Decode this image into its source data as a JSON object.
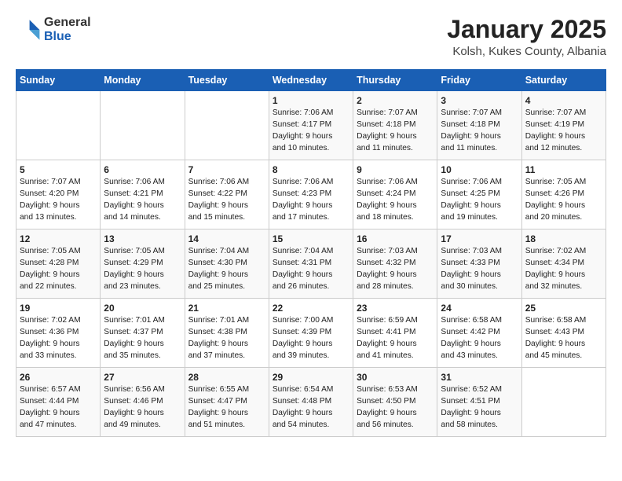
{
  "logo": {
    "general": "General",
    "blue": "Blue"
  },
  "title": "January 2025",
  "subtitle": "Kolsh, Kukes County, Albania",
  "days_of_week": [
    "Sunday",
    "Monday",
    "Tuesday",
    "Wednesday",
    "Thursday",
    "Friday",
    "Saturday"
  ],
  "weeks": [
    [
      {
        "day": "",
        "content": ""
      },
      {
        "day": "",
        "content": ""
      },
      {
        "day": "",
        "content": ""
      },
      {
        "day": "1",
        "content": "Sunrise: 7:06 AM\nSunset: 4:17 PM\nDaylight: 9 hours\nand 10 minutes."
      },
      {
        "day": "2",
        "content": "Sunrise: 7:07 AM\nSunset: 4:18 PM\nDaylight: 9 hours\nand 11 minutes."
      },
      {
        "day": "3",
        "content": "Sunrise: 7:07 AM\nSunset: 4:18 PM\nDaylight: 9 hours\nand 11 minutes."
      },
      {
        "day": "4",
        "content": "Sunrise: 7:07 AM\nSunset: 4:19 PM\nDaylight: 9 hours\nand 12 minutes."
      }
    ],
    [
      {
        "day": "5",
        "content": "Sunrise: 7:07 AM\nSunset: 4:20 PM\nDaylight: 9 hours\nand 13 minutes."
      },
      {
        "day": "6",
        "content": "Sunrise: 7:06 AM\nSunset: 4:21 PM\nDaylight: 9 hours\nand 14 minutes."
      },
      {
        "day": "7",
        "content": "Sunrise: 7:06 AM\nSunset: 4:22 PM\nDaylight: 9 hours\nand 15 minutes."
      },
      {
        "day": "8",
        "content": "Sunrise: 7:06 AM\nSunset: 4:23 PM\nDaylight: 9 hours\nand 17 minutes."
      },
      {
        "day": "9",
        "content": "Sunrise: 7:06 AM\nSunset: 4:24 PM\nDaylight: 9 hours\nand 18 minutes."
      },
      {
        "day": "10",
        "content": "Sunrise: 7:06 AM\nSunset: 4:25 PM\nDaylight: 9 hours\nand 19 minutes."
      },
      {
        "day": "11",
        "content": "Sunrise: 7:05 AM\nSunset: 4:26 PM\nDaylight: 9 hours\nand 20 minutes."
      }
    ],
    [
      {
        "day": "12",
        "content": "Sunrise: 7:05 AM\nSunset: 4:28 PM\nDaylight: 9 hours\nand 22 minutes."
      },
      {
        "day": "13",
        "content": "Sunrise: 7:05 AM\nSunset: 4:29 PM\nDaylight: 9 hours\nand 23 minutes."
      },
      {
        "day": "14",
        "content": "Sunrise: 7:04 AM\nSunset: 4:30 PM\nDaylight: 9 hours\nand 25 minutes."
      },
      {
        "day": "15",
        "content": "Sunrise: 7:04 AM\nSunset: 4:31 PM\nDaylight: 9 hours\nand 26 minutes."
      },
      {
        "day": "16",
        "content": "Sunrise: 7:03 AM\nSunset: 4:32 PM\nDaylight: 9 hours\nand 28 minutes."
      },
      {
        "day": "17",
        "content": "Sunrise: 7:03 AM\nSunset: 4:33 PM\nDaylight: 9 hours\nand 30 minutes."
      },
      {
        "day": "18",
        "content": "Sunrise: 7:02 AM\nSunset: 4:34 PM\nDaylight: 9 hours\nand 32 minutes."
      }
    ],
    [
      {
        "day": "19",
        "content": "Sunrise: 7:02 AM\nSunset: 4:36 PM\nDaylight: 9 hours\nand 33 minutes."
      },
      {
        "day": "20",
        "content": "Sunrise: 7:01 AM\nSunset: 4:37 PM\nDaylight: 9 hours\nand 35 minutes."
      },
      {
        "day": "21",
        "content": "Sunrise: 7:01 AM\nSunset: 4:38 PM\nDaylight: 9 hours\nand 37 minutes."
      },
      {
        "day": "22",
        "content": "Sunrise: 7:00 AM\nSunset: 4:39 PM\nDaylight: 9 hours\nand 39 minutes."
      },
      {
        "day": "23",
        "content": "Sunrise: 6:59 AM\nSunset: 4:41 PM\nDaylight: 9 hours\nand 41 minutes."
      },
      {
        "day": "24",
        "content": "Sunrise: 6:58 AM\nSunset: 4:42 PM\nDaylight: 9 hours\nand 43 minutes."
      },
      {
        "day": "25",
        "content": "Sunrise: 6:58 AM\nSunset: 4:43 PM\nDaylight: 9 hours\nand 45 minutes."
      }
    ],
    [
      {
        "day": "26",
        "content": "Sunrise: 6:57 AM\nSunset: 4:44 PM\nDaylight: 9 hours\nand 47 minutes."
      },
      {
        "day": "27",
        "content": "Sunrise: 6:56 AM\nSunset: 4:46 PM\nDaylight: 9 hours\nand 49 minutes."
      },
      {
        "day": "28",
        "content": "Sunrise: 6:55 AM\nSunset: 4:47 PM\nDaylight: 9 hours\nand 51 minutes."
      },
      {
        "day": "29",
        "content": "Sunrise: 6:54 AM\nSunset: 4:48 PM\nDaylight: 9 hours\nand 54 minutes."
      },
      {
        "day": "30",
        "content": "Sunrise: 6:53 AM\nSunset: 4:50 PM\nDaylight: 9 hours\nand 56 minutes."
      },
      {
        "day": "31",
        "content": "Sunrise: 6:52 AM\nSunset: 4:51 PM\nDaylight: 9 hours\nand 58 minutes."
      },
      {
        "day": "",
        "content": ""
      }
    ]
  ]
}
